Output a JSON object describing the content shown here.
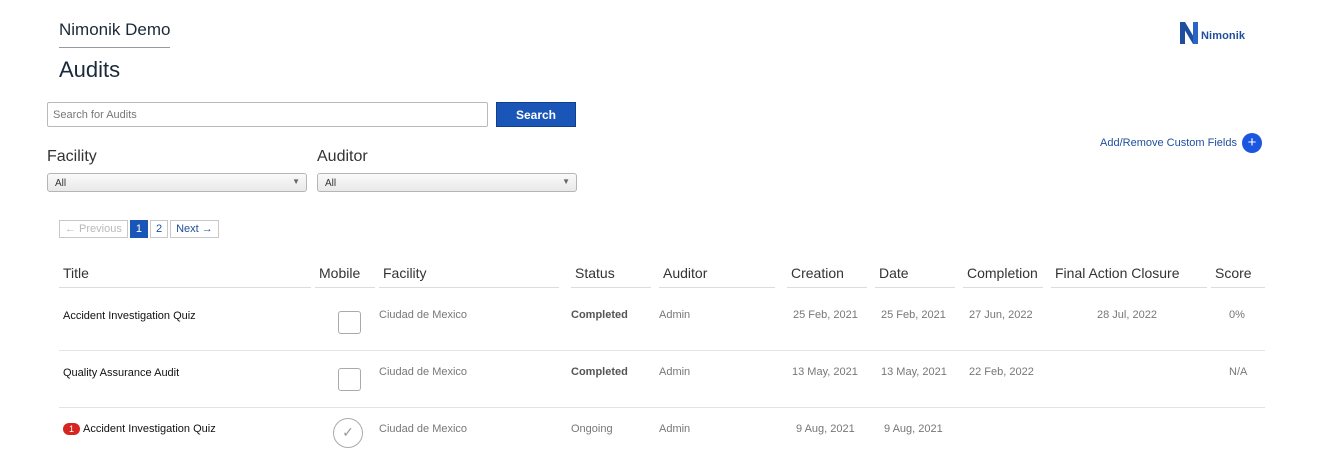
{
  "header": {
    "org_name": "Nimonik Demo",
    "page_title": "Audits"
  },
  "brand": {
    "name": "Nimonik"
  },
  "search": {
    "placeholder": "Search for Audits",
    "button_label": "Search"
  },
  "filters": {
    "facility": {
      "label": "Facility",
      "value": "All"
    },
    "auditor": {
      "label": "Auditor",
      "value": "All"
    }
  },
  "custom_fields": {
    "label": "Add/Remove Custom Fields"
  },
  "pagination": {
    "previous": "← Previous",
    "pages": [
      "1",
      "2"
    ],
    "current": "1",
    "next": "Next →"
  },
  "table": {
    "columns": [
      "Title",
      "Mobile",
      "Facility",
      "Status",
      "Auditor",
      "Creation",
      "Date",
      "Completion",
      "Final Action Closure",
      "Score"
    ],
    "rows": [
      {
        "badge": "",
        "title": "Accident Investigation Quiz",
        "mobile": "unchecked",
        "facility": "Ciudad de Mexico",
        "status": "Completed",
        "auditor": "Admin",
        "creation": "25 Feb, 2021",
        "date": "25 Feb, 2021",
        "completion": "27 Jun, 2022",
        "closure": "28 Jul, 2022",
        "score": "0%"
      },
      {
        "badge": "",
        "title": "Quality Assurance Audit",
        "mobile": "unchecked",
        "facility": "Ciudad de Mexico",
        "status": "Completed",
        "auditor": "Admin",
        "creation": "13 May, 2021",
        "date": "13 May, 2021",
        "completion": "22 Feb, 2022",
        "closure": "",
        "score": "N/A"
      },
      {
        "badge": "1",
        "title": "Accident Investigation Quiz",
        "mobile": "checked",
        "facility": "Ciudad de Mexico",
        "status": "Ongoing",
        "auditor": "Admin",
        "creation": "9 Aug, 2021",
        "date": "9 Aug, 2021",
        "completion": "",
        "closure": "",
        "score": ""
      }
    ]
  },
  "colors": {
    "primary": "#1a56b8",
    "link": "#1f4e9c",
    "badge": "#d6251f"
  },
  "icons": {
    "add": "plus-icon",
    "mobile_checked": "check-circle-icon",
    "select_caret": "caret-down-icon"
  }
}
